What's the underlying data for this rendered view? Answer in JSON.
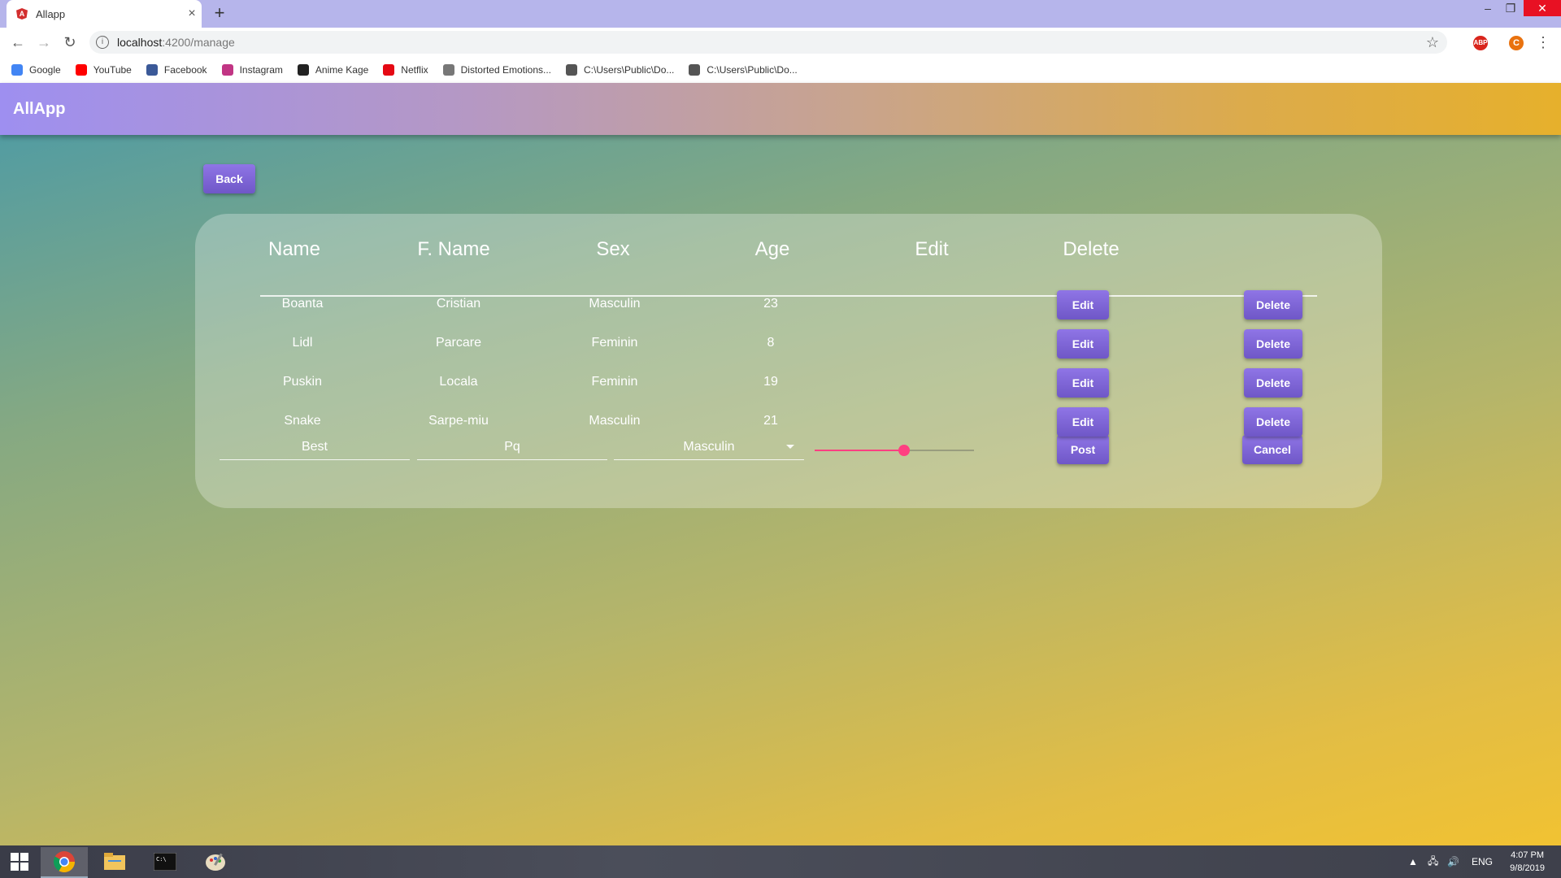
{
  "browser": {
    "tab_title": "Allapp",
    "url_host": "localhost",
    "url_path": ":4200/manage",
    "bookmarks": [
      {
        "label": "Google",
        "icon": "google-icon",
        "color": "#4285f4"
      },
      {
        "label": "YouTube",
        "icon": "youtube-icon",
        "color": "#ff0000"
      },
      {
        "label": "Facebook",
        "icon": "facebook-icon",
        "color": "#3b5998"
      },
      {
        "label": "Instagram",
        "icon": "instagram-icon",
        "color": "#c13584"
      },
      {
        "label": "Anime Kage",
        "icon": "animekage-icon",
        "color": "#222222"
      },
      {
        "label": "Netflix",
        "icon": "netflix-icon",
        "color": "#e50914"
      },
      {
        "label": "Distorted Emotions...",
        "icon": "distorted-icon",
        "color": "#777777"
      },
      {
        "label": "C:\\Users\\Public\\Do...",
        "icon": "globe-icon",
        "color": "#555555"
      },
      {
        "label": "C:\\Users\\Public\\Do...",
        "icon": "globe-icon",
        "color": "#555555"
      }
    ],
    "ext_abp": "ABP",
    "profile_initial": "C"
  },
  "app": {
    "brand": "AllApp",
    "back_label": "Back",
    "headers": [
      "Name",
      "F. Name",
      "Sex",
      "Age",
      "Edit",
      "Delete"
    ],
    "rows": [
      {
        "name": "Boanta",
        "fname": "Cristian",
        "sex": "Masculin",
        "age": "23"
      },
      {
        "name": "Lidl",
        "fname": "Parcare",
        "sex": "Feminin",
        "age": "8"
      },
      {
        "name": "Puskin",
        "fname": "Locala",
        "sex": "Feminin",
        "age": "19"
      },
      {
        "name": "Snake",
        "fname": "Sarpe-miu",
        "sex": "Masculin",
        "age": "21"
      }
    ],
    "edit_label": "Edit",
    "delete_label": "Delete",
    "form": {
      "name_value": "Best",
      "fname_value": "Pq",
      "sex_value": "Masculin",
      "age_slider_fraction": 0.56,
      "post_label": "Post",
      "cancel_label": "Cancel"
    },
    "colors": {
      "button": "#7c63d6",
      "slider_accent": "#ff4081"
    }
  },
  "taskbar": {
    "lang": "ENG",
    "time": "4:07 PM",
    "date": "9/8/2019"
  }
}
